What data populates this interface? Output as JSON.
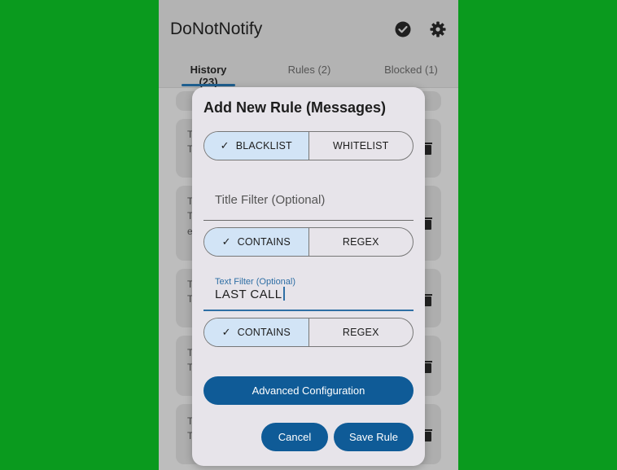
{
  "app": {
    "title": "DoNotNotify"
  },
  "tabs": [
    {
      "label": "History (23)"
    },
    {
      "label": "Rules (2)"
    },
    {
      "label": "Blocked (1)"
    }
  ],
  "list_card_text": {
    "line_t": "T",
    "line_e": "e"
  },
  "icons": {
    "check": "check-circle-icon",
    "settings": "gear-icon",
    "delete": "trash-icon"
  },
  "dialog": {
    "title": "Add New Rule (Messages)",
    "mode": {
      "options": [
        "BLACKLIST",
        "WHITELIST"
      ],
      "selected": "BLACKLIST"
    },
    "title_filter": {
      "placeholder": "Title Filter (Optional)",
      "value": "",
      "match": {
        "options": [
          "CONTAINS",
          "REGEX"
        ],
        "selected": "CONTAINS"
      }
    },
    "text_filter": {
      "label": "Text Filter (Optional)",
      "value": "LAST CALL",
      "match": {
        "options": [
          "CONTAINS",
          "REGEX"
        ],
        "selected": "CONTAINS"
      }
    },
    "advanced_label": "Advanced Configuration",
    "cancel_label": "Cancel",
    "save_label": "Save Rule",
    "check_glyph": "✓"
  },
  "colors": {
    "background": "#0a9a1e",
    "primary": "#0f5b97",
    "selected_segment": "#d2e4f6",
    "focus": "#2f6fa5"
  }
}
